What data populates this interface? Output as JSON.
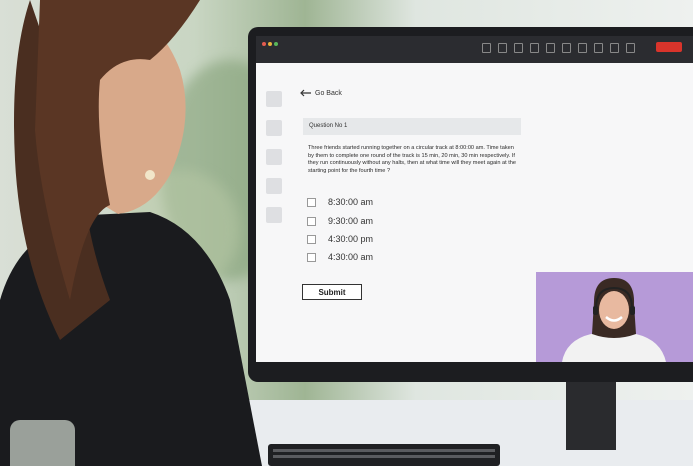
{
  "nav": {
    "back_label": "Go Back"
  },
  "question": {
    "heading": "Question No 1",
    "text": "Three friends started running together on a circular track at 8:00:00 am. Time taken by them to complete one round of the track is 15 min, 20 min, 30 min respectively. If they run continuously without any halts, then at what time will they meet again at the starting point for the fourth time ?"
  },
  "options": [
    "8:30:00 am",
    "9:30:00 am",
    "4:30:00 pm",
    "4:30:00 am"
  ],
  "submit_label": "Submit",
  "colors": {
    "end_button": "#d9342b",
    "video_bg": "#b69ad8",
    "topbar": "#2b2c30"
  },
  "icons": [
    "arrow-left-icon",
    "checkbox-icon",
    "end-call-icon"
  ]
}
